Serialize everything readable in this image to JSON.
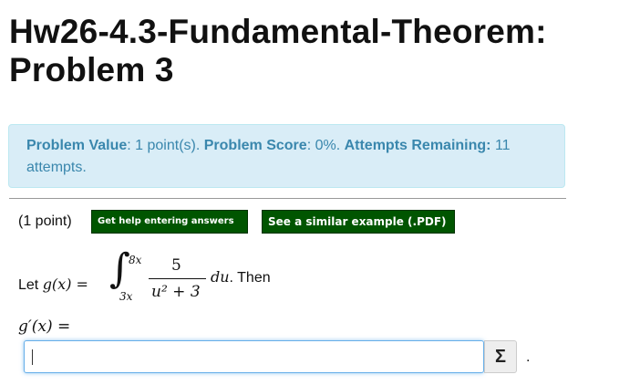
{
  "page": {
    "title_line1": "Hw26-4.3-Fundamental-Theorem:",
    "title_line2": "Problem 3"
  },
  "info": {
    "value_label": "Problem Value",
    "value_text": ": 1 point(s). ",
    "score_label": "Problem Score",
    "score_text": ": 0%. ",
    "attempts_label": "Attempts Remaining:",
    "attempts_text": " 11 attempts."
  },
  "problem": {
    "points": "(1 point)",
    "help_button": "Get help entering answers",
    "example_button": "See a similar example (.PDF)",
    "intro": "Let ",
    "g_of_x": "g(x) =",
    "upper_limit": "8x",
    "lower_limit": "3x",
    "numerator": "5",
    "denominator": "u² + 3",
    "du": "du",
    "then": ". Then",
    "answer_label": "g′(x) =",
    "answer_value": "",
    "sigma": "Σ",
    "trail": "."
  }
}
